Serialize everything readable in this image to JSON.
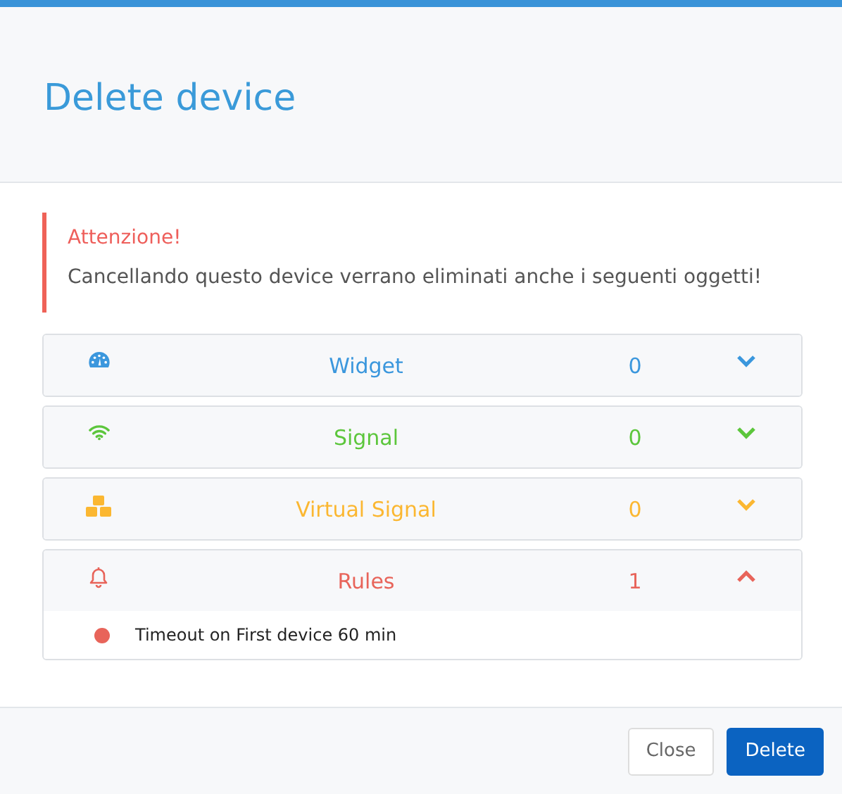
{
  "dialog": {
    "title": "Delete device"
  },
  "alert": {
    "title": "Attenzione!",
    "message": "Cancellando questo device verrano eliminati anche i seguenti oggetti!"
  },
  "sections": [
    {
      "kind": "widget",
      "label": "Widget",
      "count": "0",
      "color": "#3b97dd",
      "expanded": false
    },
    {
      "kind": "signal",
      "label": "Signal",
      "count": "0",
      "color": "#5cc63c",
      "expanded": false
    },
    {
      "kind": "virtual",
      "label": "Virtual Signal",
      "count": "0",
      "color": "#fbb731",
      "expanded": false
    },
    {
      "kind": "rules",
      "label": "Rules",
      "count": "1",
      "color": "#e8645a",
      "expanded": true,
      "items": [
        {
          "text": "Timeout on First device 60 min",
          "color": "#e8645a"
        }
      ]
    }
  ],
  "buttons": [
    {
      "kind": "secondary",
      "label": "Close"
    },
    {
      "kind": "primary",
      "label": "Delete"
    }
  ]
}
